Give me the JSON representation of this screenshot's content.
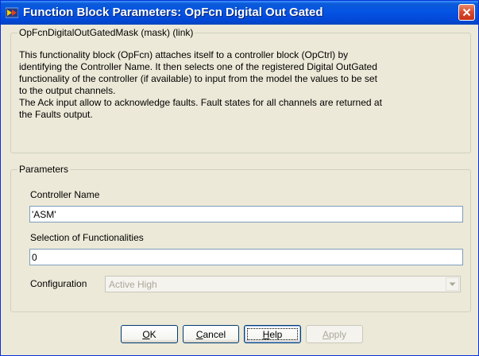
{
  "window": {
    "title": "Function Block Parameters: OpFcn Digital Out Gated"
  },
  "description_group": {
    "legend": "OpFcnDigitalOutGatedMask (mask) (link)",
    "lines": [
      "This functionality block (OpFcn) attaches itself to a controller block (OpCtrl) by",
      "identifying the Controller Name.  It then selects one of the registered Digital OutGated",
      "functionality of the controller (if available) to input from the model the values to be set",
      "to the output channels.",
      "The Ack input allow to acknowledge faults. Fault states for all channels are returned at",
      "the Faults output."
    ]
  },
  "parameters_group": {
    "legend": "Parameters",
    "controller_name": {
      "label": "Controller Name",
      "value": "'ASM'"
    },
    "selection": {
      "label": "Selection of Functionalities",
      "value": "0"
    },
    "configuration": {
      "label": "Configuration",
      "value": "Active High"
    }
  },
  "buttons": {
    "ok": {
      "mnemonic": "O",
      "rest": "K"
    },
    "cancel": {
      "mnemonic": "C",
      "rest": "ancel"
    },
    "help": {
      "mnemonic": "H",
      "rest": "elp"
    },
    "apply": {
      "mnemonic": "A",
      "rest": "pply"
    }
  },
  "icons": {
    "app": "simulink-block-icon",
    "close": "close-icon",
    "dropdown": "chevron-down-icon"
  },
  "colors": {
    "titlebar": "#0554e3",
    "close_button": "#d9482a",
    "dialog_background": "#ece9d8"
  }
}
